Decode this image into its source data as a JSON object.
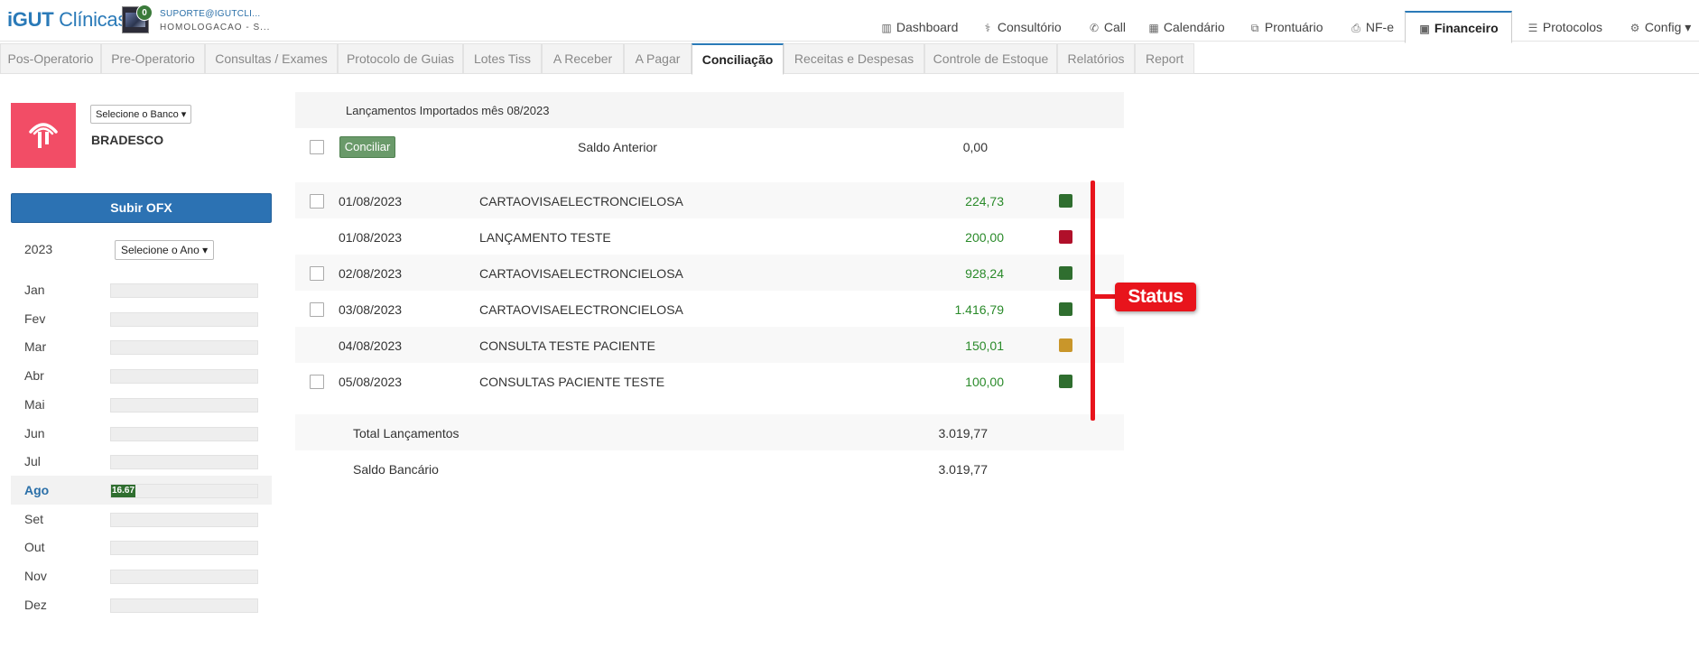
{
  "app": {
    "logo_bold": "iGUT",
    "logo_light": " Clínicas"
  },
  "user": {
    "notifications": "0",
    "email": "SUPORTE@IGUTCLI...",
    "subtitle": "HOMOLOGACAO - S..."
  },
  "main_nav": [
    {
      "label": "Dashboard",
      "icon": "bar-chart-icon",
      "glyph": "▥"
    },
    {
      "label": "Consultório",
      "icon": "stethoscope-icon",
      "glyph": "⚕"
    },
    {
      "label": "Call",
      "icon": "phone-icon",
      "glyph": "✆"
    },
    {
      "label": "Calendário",
      "icon": "calendar-icon",
      "glyph": "▦"
    },
    {
      "label": "Prontuário",
      "icon": "copy-icon",
      "glyph": "⧉"
    },
    {
      "label": "NF-e",
      "icon": "print-icon",
      "glyph": "⎙"
    },
    {
      "label": "Financeiro",
      "icon": "money-icon",
      "glyph": "▣"
    },
    {
      "label": "Protocolos",
      "icon": "list-icon",
      "glyph": "☰"
    },
    {
      "label": "Config",
      "icon": "gear-icon",
      "glyph": "⚙",
      "caret": "▾"
    }
  ],
  "sub_tabs": [
    "Pos-Operatorio",
    "Pre-Operatorio",
    "Consultas / Exames",
    "Protocolo de Guias",
    "Lotes Tiss",
    "A Receber",
    "A Pagar",
    "Conciliação",
    "Receitas e Despesas",
    "Controle de Estoque",
    "Relatórios",
    "Report"
  ],
  "active_sub_tab": "Conciliação",
  "bank": {
    "select_label": "Selecione o Banco",
    "name": "BRADESCO",
    "brand_color": "#f24d66"
  },
  "upload_button": "Subir OFX",
  "year": {
    "value": "2023",
    "select_label": "Selecione o Ano"
  },
  "months": [
    {
      "name": "Jan",
      "progress": null
    },
    {
      "name": "Fev",
      "progress": null
    },
    {
      "name": "Mar",
      "progress": null
    },
    {
      "name": "Abr",
      "progress": null
    },
    {
      "name": "Mai",
      "progress": null
    },
    {
      "name": "Jun",
      "progress": null
    },
    {
      "name": "Jul",
      "progress": null
    },
    {
      "name": "Ago",
      "progress": 16.67,
      "progress_label": "16.67",
      "active": true
    },
    {
      "name": "Set",
      "progress": null
    },
    {
      "name": "Out",
      "progress": null
    },
    {
      "name": "Nov",
      "progress": null
    },
    {
      "name": "Dez",
      "progress": null
    }
  ],
  "table": {
    "header": "Lançamentos Importados mês 08/2023",
    "conciliar_button": "Conciliar",
    "saldo_anterior_label": "Saldo Anterior",
    "saldo_anterior_value": "0,00",
    "rows": [
      {
        "date": "01/08/2023",
        "description": "CARTAOVISAELECTRONCIELOSA",
        "value": "224,73",
        "status": "green",
        "checkbox": true
      },
      {
        "date": "01/08/2023",
        "description": "LANÇAMENTO TESTE",
        "value": "200,00",
        "status": "red",
        "checkbox": false
      },
      {
        "date": "02/08/2023",
        "description": "CARTAOVISAELECTRONCIELOSA",
        "value": "928,24",
        "status": "green",
        "checkbox": true
      },
      {
        "date": "03/08/2023",
        "description": "CARTAOVISAELECTRONCIELOSA",
        "value": "1.416,79",
        "status": "green",
        "checkbox": true
      },
      {
        "date": "04/08/2023",
        "description": "CONSULTA TESTE PACIENTE",
        "value": "150,01",
        "status": "yellow",
        "checkbox": false
      },
      {
        "date": "05/08/2023",
        "description": "CONSULTAS PACIENTE TESTE",
        "value": "100,00",
        "status": "green",
        "checkbox": true
      }
    ],
    "total_label": "Total Lançamentos",
    "total_value": "3.019,77",
    "saldo_bancario_label": "Saldo Bancário",
    "saldo_bancario_value": "3.019,77"
  },
  "status_colors": {
    "green": "#2f6e2f",
    "red": "#b0102a",
    "yellow": "#c9962a"
  },
  "annotation": {
    "label": "Status"
  }
}
